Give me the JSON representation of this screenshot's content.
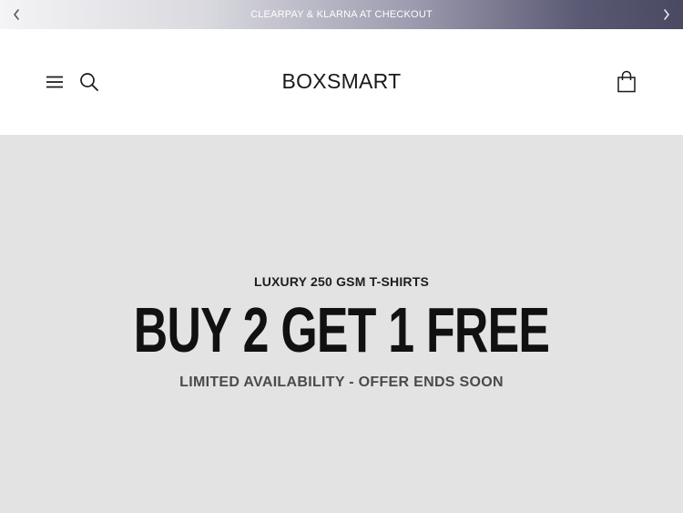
{
  "announcement": {
    "text": "CLEARPAY & KLARNA AT CHECKOUT",
    "prev_icon": "chevron-left-icon",
    "next_icon": "chevron-right-icon"
  },
  "header": {
    "logo": "BOXSMART",
    "menu_icon": "hamburger-menu-icon",
    "search_icon": "search-icon",
    "cart_icon": "shopping-bag-icon"
  },
  "hero": {
    "eyebrow": "LUXURY 250 GSM T-SHIRTS",
    "title": "BUY 2 GET 1 FREE",
    "subtitle": "LIMITED AVAILABILITY - OFFER ENDS SOON",
    "background_color": "#e3e3e3"
  }
}
